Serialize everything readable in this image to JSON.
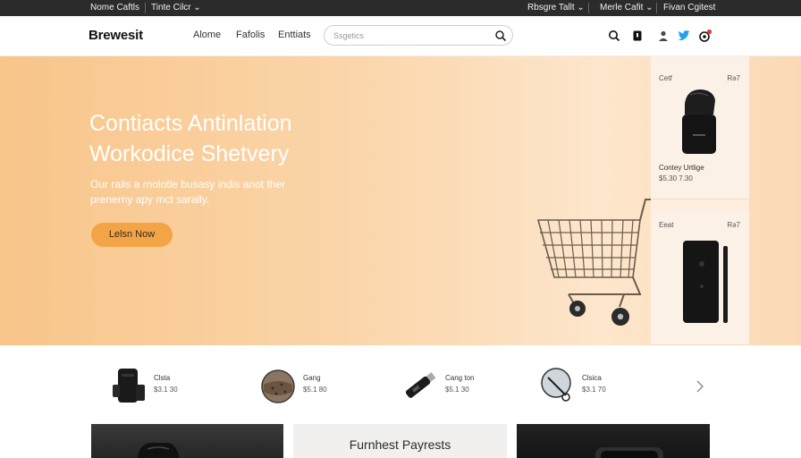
{
  "topbar": {
    "left_link_1": "Nome Caftls",
    "left_link_2": "Tinte Cilcr",
    "right_link_1": "Rbsgre Tallt",
    "right_link_2": "Merle Cafit",
    "right_link_3": "Fivan Cgitest"
  },
  "header": {
    "logo": "Brewesit",
    "nav": [
      "Alome",
      "Fafolis",
      "Enttiats"
    ],
    "search_placeholder": "Ssgetics"
  },
  "hero": {
    "title": "Contiacts Antinlation Workodice Shetvery",
    "subtitle": "Our rails a rnolotle busasy indis anot ther prenerny apy mct sarally.",
    "cta_label": "Lelsn Now"
  },
  "side_cards": [
    {
      "tag_left": "Cetf",
      "tag_right": "Rə7",
      "name": "Contey Urtlige",
      "price": "$5.30 7.30"
    },
    {
      "tag_left": "Eeat",
      "tag_right": "Rə7",
      "name": "",
      "price": ""
    }
  ],
  "products": [
    {
      "name": "Clsta",
      "price": "$3.1 30"
    },
    {
      "name": "Gang",
      "price": "$5.1 80"
    },
    {
      "name": "Cang ton",
      "price": "$5.1 30"
    },
    {
      "name": "Clsica",
      "price": "$3.1 70"
    }
  ],
  "tiles": {
    "middle_title": "Furnhest Payrests"
  },
  "colors": {
    "topbar_bg": "#2b2b2b",
    "hero_start": "#f8c58a",
    "hero_end": "#fde6cc",
    "cta_bg": "#f3a447",
    "twitter_blue": "#1da1f2",
    "badge_red": "#e53935"
  }
}
